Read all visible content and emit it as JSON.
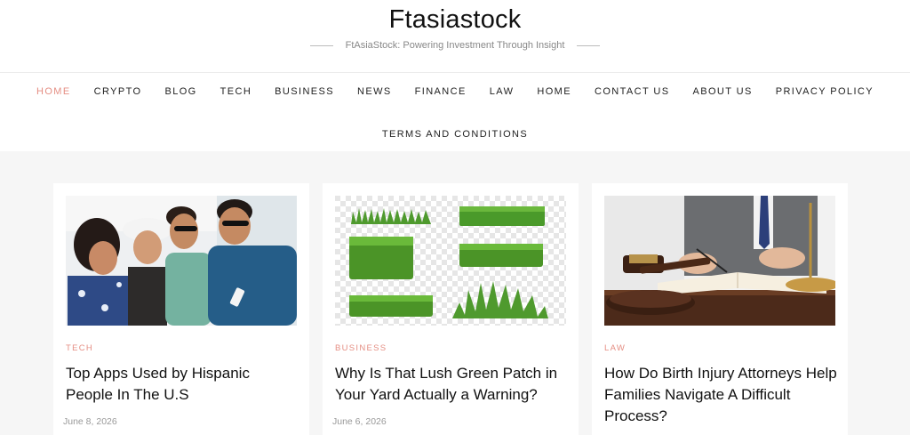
{
  "site": {
    "title": "Ftasiastock",
    "tagline": "FtAsiaStock: Powering Investment Through Insight"
  },
  "nav": {
    "row1": [
      "HOME",
      "CRYPTO",
      "BLOG",
      "TECH",
      "BUSINESS",
      "NEWS",
      "FINANCE",
      "LAW",
      "HOME",
      "CONTACT US",
      "ABOUT US",
      "PRIVACY POLICY"
    ],
    "row2": "TERMS AND CONDITIONS",
    "active_index": 0
  },
  "posts": [
    {
      "category": "TECH",
      "title": "Top Apps Used by Hispanic People In The U.S",
      "date": "June 8, 2026",
      "image": "group-of-friends-looking-at-phone"
    },
    {
      "category": "BUSINESS",
      "title": "Why Is That Lush Green Patch in Your Yard Actually a Warning?",
      "date": "June 6, 2026",
      "image": "grass-patches-on-transparent-background"
    },
    {
      "category": "LAW",
      "title": "How Do Birth Injury Attorneys Help Families Navigate A Difficult Process?",
      "date": "",
      "image": "lawyer-with-gavel-and-scales"
    }
  ],
  "colors": {
    "accent": "#e58e83",
    "background": "#f6f6f6"
  }
}
